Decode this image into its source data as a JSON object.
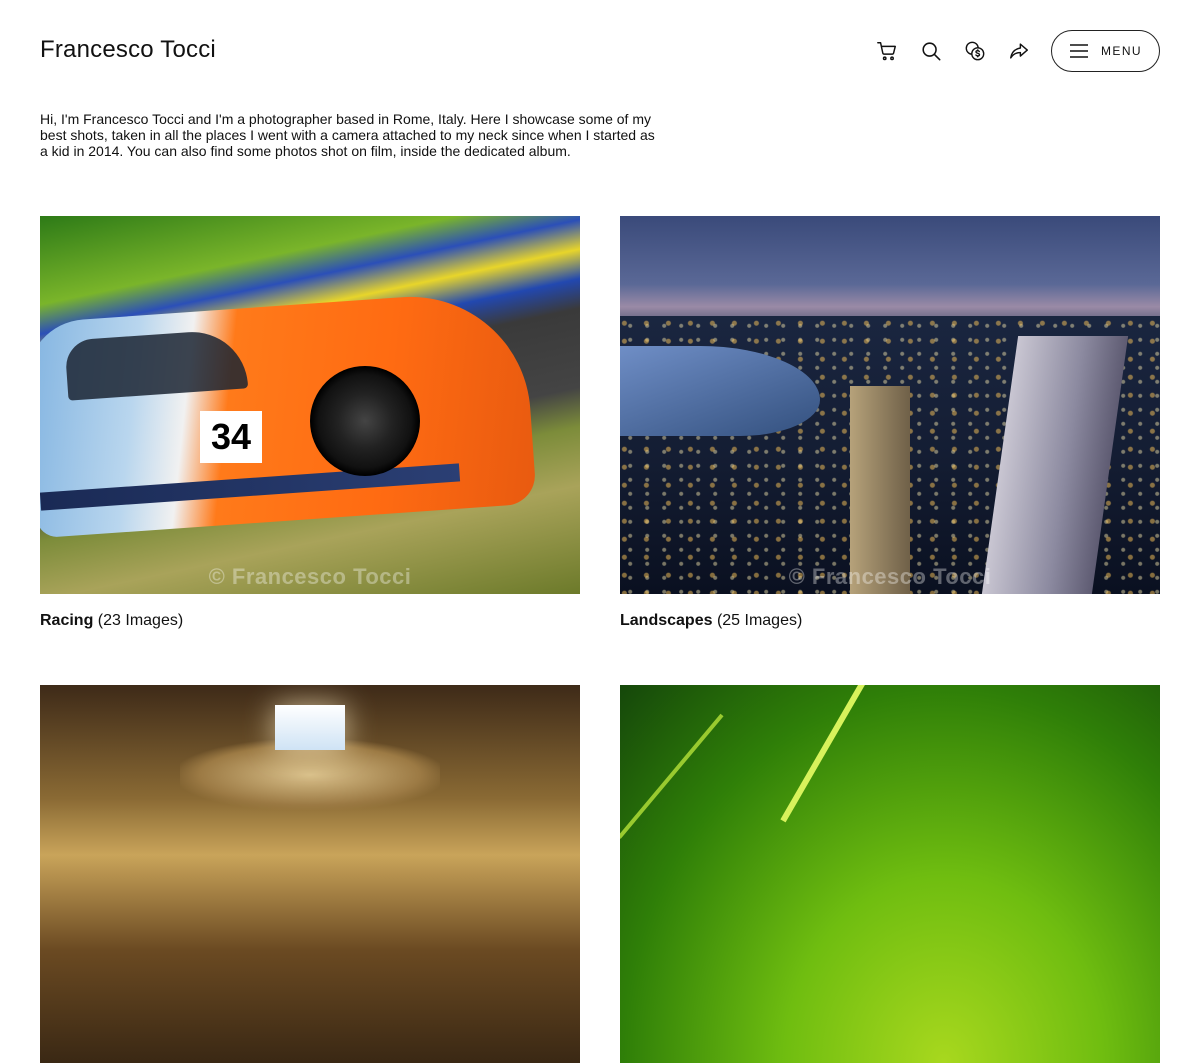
{
  "site": {
    "title": "Francesco Tocci"
  },
  "toolbar": {
    "icons": [
      "cart-icon",
      "search-icon",
      "currency-icon",
      "share-icon"
    ],
    "menu_label": "MENU"
  },
  "intro": {
    "text": "Hi, I'm Francesco Tocci and I'm a photographer based in Rome, Italy. Here I showcase some of my best shots, taken in all the places I went with a camera attached to my neck since when I started as a kid in 2014. You can also find some photos shot on film, inside the dedicated album."
  },
  "albums": [
    {
      "name": "Racing",
      "count": "(23 Images)",
      "watermark": "© Francesco Tocci",
      "plate": "34"
    },
    {
      "name": "Landscapes",
      "count": "(25 Images)",
      "watermark": "© Francesco Tocci"
    },
    {
      "name": "",
      "count": ""
    },
    {
      "name": "",
      "count": ""
    }
  ]
}
